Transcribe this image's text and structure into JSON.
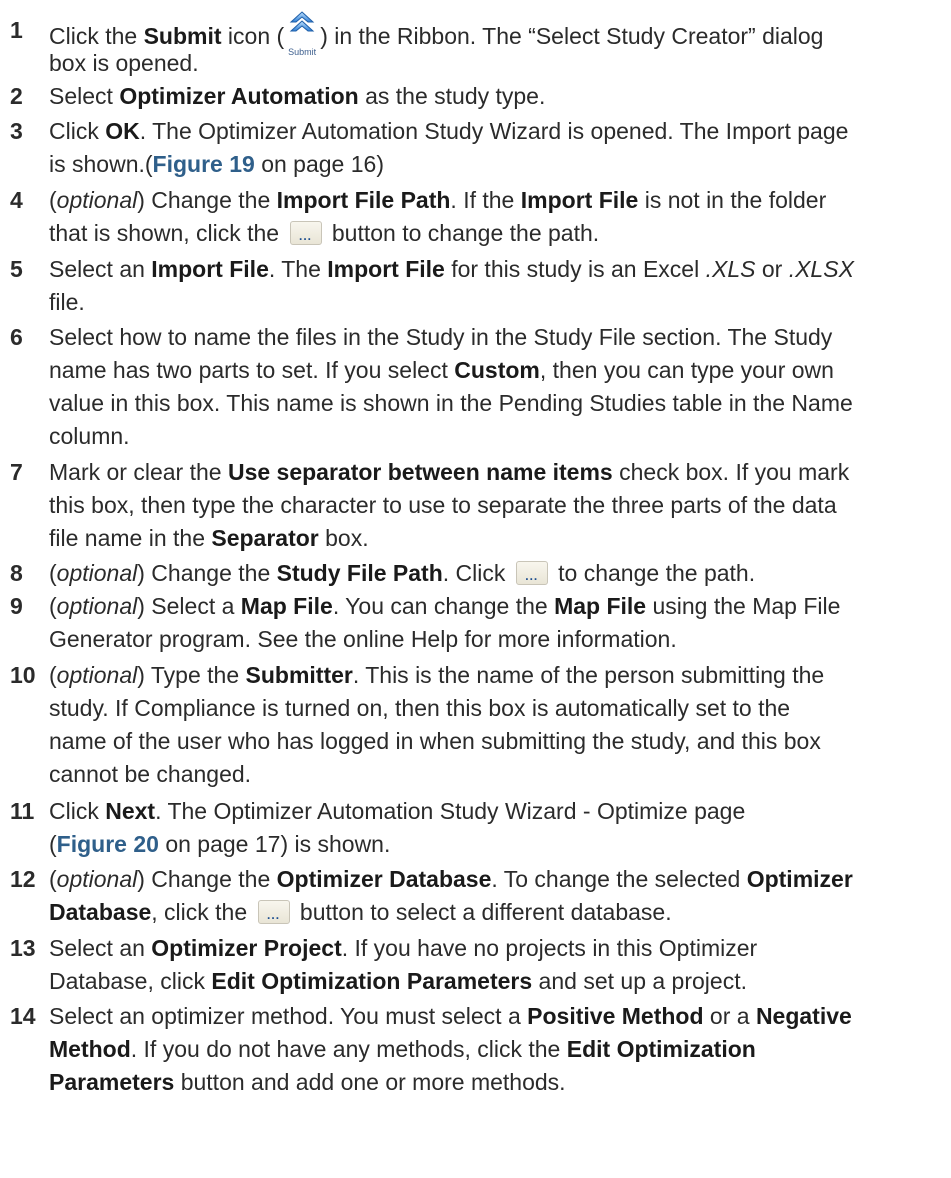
{
  "steps": [
    {
      "num": "1",
      "lines": [
        [
          "Click the ",
          {
            "b": "Submit"
          },
          " icon (",
          {
            "icon": "submit"
          },
          ") in the Ribbon. The “Select Study Creator” dialog"
        ],
        [
          "box is opened."
        ]
      ]
    },
    {
      "num": "2",
      "lines": [
        [
          "Select ",
          {
            "b": "Optimizer Automation"
          },
          " as the study type."
        ]
      ]
    },
    {
      "num": "3",
      "lines": [
        [
          "Click ",
          {
            "b": "OK"
          },
          ". The Optimizer Automation Study Wizard is opened. The Import page"
        ],
        [
          "is shown.(",
          {
            "x": "Figure 19"
          },
          " on page 16)"
        ]
      ]
    },
    {
      "num": "4",
      "lines": [
        [
          "(",
          {
            "i": "optional"
          },
          ") Change the ",
          {
            "b": "Import File Path"
          },
          ". If the ",
          {
            "b": "Import File"
          },
          " is not in the folder"
        ],
        [
          "that is shown, click the ",
          {
            "icon": "browse"
          },
          " button to change the path."
        ]
      ]
    },
    {
      "num": "5",
      "lines": [
        [
          "Select an ",
          {
            "b": "Import File"
          },
          ". The ",
          {
            "b": "Import File"
          },
          " for this study is an Excel ",
          {
            "i": ".XLS"
          },
          " or ",
          {
            "i": ".XLSX"
          }
        ],
        [
          "file."
        ]
      ]
    },
    {
      "num": "6",
      "lines": [
        [
          "Select how to name the files in the Study in the Study File section. The Study"
        ],
        [
          "name has two parts to set. If you select ",
          {
            "b": "Custom"
          },
          ", then you can type your own"
        ],
        [
          "value in this box. This name is shown in the Pending Studies table in the Name"
        ],
        [
          "column."
        ]
      ]
    },
    {
      "num": "7",
      "lines": [
        [
          "Mark or clear the ",
          {
            "b": "Use separator between name items"
          },
          " check box. If you mark"
        ],
        [
          "this box, then type the character to use to separate the three parts of the data"
        ],
        [
          "file name in the ",
          {
            "b": "Separator"
          },
          " box."
        ]
      ]
    },
    {
      "num": "8",
      "lines": [
        [
          "(",
          {
            "i": "optional"
          },
          ") Change the ",
          {
            "b": "Study File Path"
          },
          ". Click ",
          {
            "icon": "browse"
          },
          " to change the path."
        ]
      ]
    },
    {
      "num": "9",
      "lines": [
        [
          "(",
          {
            "i": "optional"
          },
          ") Select a ",
          {
            "b": "Map File"
          },
          ". You can change the ",
          {
            "b": "Map File"
          },
          " using the Map File"
        ],
        [
          "Generator program. See the online Help for more information."
        ]
      ]
    },
    {
      "num": "10",
      "lines": [
        [
          "(",
          {
            "i": "optional"
          },
          ") Type the ",
          {
            "b": "Submitter"
          },
          ". This is the name of the person submitting the"
        ],
        [
          "study. If Compliance is turned on, then this box is automatically set to the"
        ],
        [
          "name of the user who has logged in when submitting the study, and this box"
        ],
        [
          "cannot be changed."
        ]
      ]
    },
    {
      "num": "11",
      "lines": [
        [
          "Click ",
          {
            "b": "Next"
          },
          ". The Optimizer Automation Study Wizard - Optimize page"
        ],
        [
          "(",
          {
            "x": "Figure 20"
          },
          " on page 17) is shown."
        ]
      ]
    },
    {
      "num": "12",
      "lines": [
        [
          "(",
          {
            "i": "optional"
          },
          ") Change the ",
          {
            "b": "Optimizer Database"
          },
          ". To change the selected ",
          {
            "b": "Optimizer"
          }
        ],
        [
          {
            "b": "Database"
          },
          ", click the ",
          {
            "icon": "browse"
          },
          " button to select a different database."
        ]
      ]
    },
    {
      "num": "13",
      "lines": [
        [
          "Select an ",
          {
            "b": "Optimizer Project"
          },
          ". If you have no projects in this Optimizer"
        ],
        [
          "Database, click ",
          {
            "b": "Edit Optimization Parameters"
          },
          " and set up a project."
        ]
      ]
    },
    {
      "num": "14",
      "lines": [
        [
          "Select an optimizer method. You must select a ",
          {
            "b": "Positive Method"
          },
          " or a ",
          {
            "b": "Negative"
          }
        ],
        [
          {
            "b": "Method"
          },
          ". If you do not have any methods, click the ",
          {
            "b": "Edit Optimization"
          }
        ],
        [
          {
            "b": "Parameters"
          },
          " button and add one or more methods."
        ]
      ]
    }
  ],
  "icons": {
    "submit": {
      "name": "submit-icon",
      "caption": "Submit",
      "color": "#2f7fd6"
    },
    "browse": {
      "name": "browse-button",
      "caption": "..."
    }
  }
}
